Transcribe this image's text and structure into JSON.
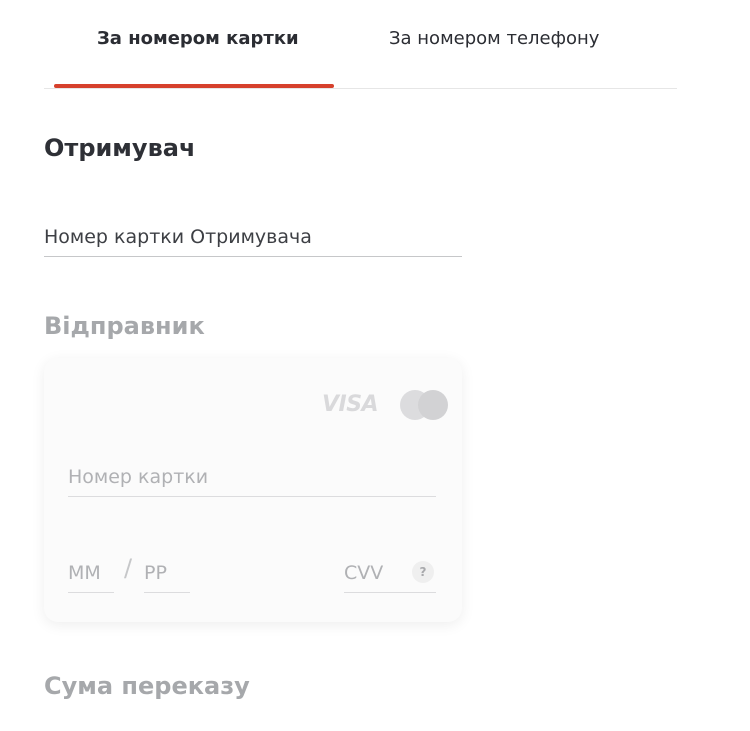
{
  "tabs": {
    "card": "За номером картки",
    "phone": "За номером телефону",
    "active": "card",
    "accent_color": "#d6402c"
  },
  "recipient": {
    "title": "Отримувач",
    "card_number_placeholder": "Номер картки Отримувача"
  },
  "sender": {
    "title": "Відправник",
    "card_brands": [
      "VISA",
      "mastercard"
    ],
    "visa_label": "VISA",
    "card_number_placeholder": "Номер картки",
    "month_placeholder": "ММ",
    "year_placeholder": "РР",
    "cvv_placeholder": "CVV",
    "cvv_help": "?"
  },
  "amount": {
    "title": "Сума переказу"
  }
}
